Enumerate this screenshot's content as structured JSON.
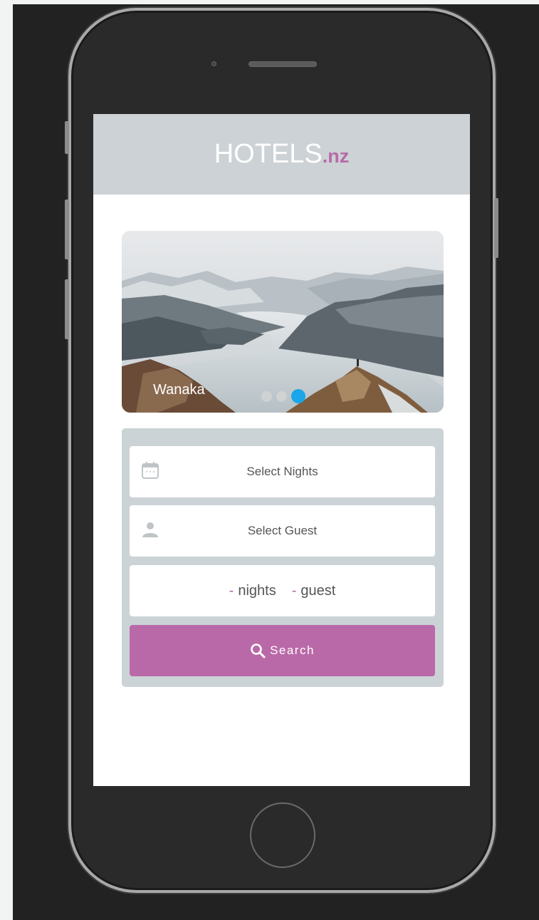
{
  "header": {
    "logo_main": "HOTELS",
    "logo_tld": ".nz"
  },
  "hero": {
    "location": "Wanaka",
    "slides_total": 3,
    "active_slide": 3
  },
  "form": {
    "nights_label": "Select Nights",
    "guest_label": "Select Guest",
    "summary": {
      "nights_value": "-",
      "nights_unit": "nights",
      "guest_value": "-",
      "guest_unit": "guest"
    },
    "search_label": "Search"
  },
  "colors": {
    "accent": "#ba69a8",
    "header_bg": "#ccd2d5",
    "dot_active": "#1aa6e8"
  },
  "icons": {
    "nights": "calendar-icon",
    "guest": "person-icon",
    "search": "search-icon"
  }
}
